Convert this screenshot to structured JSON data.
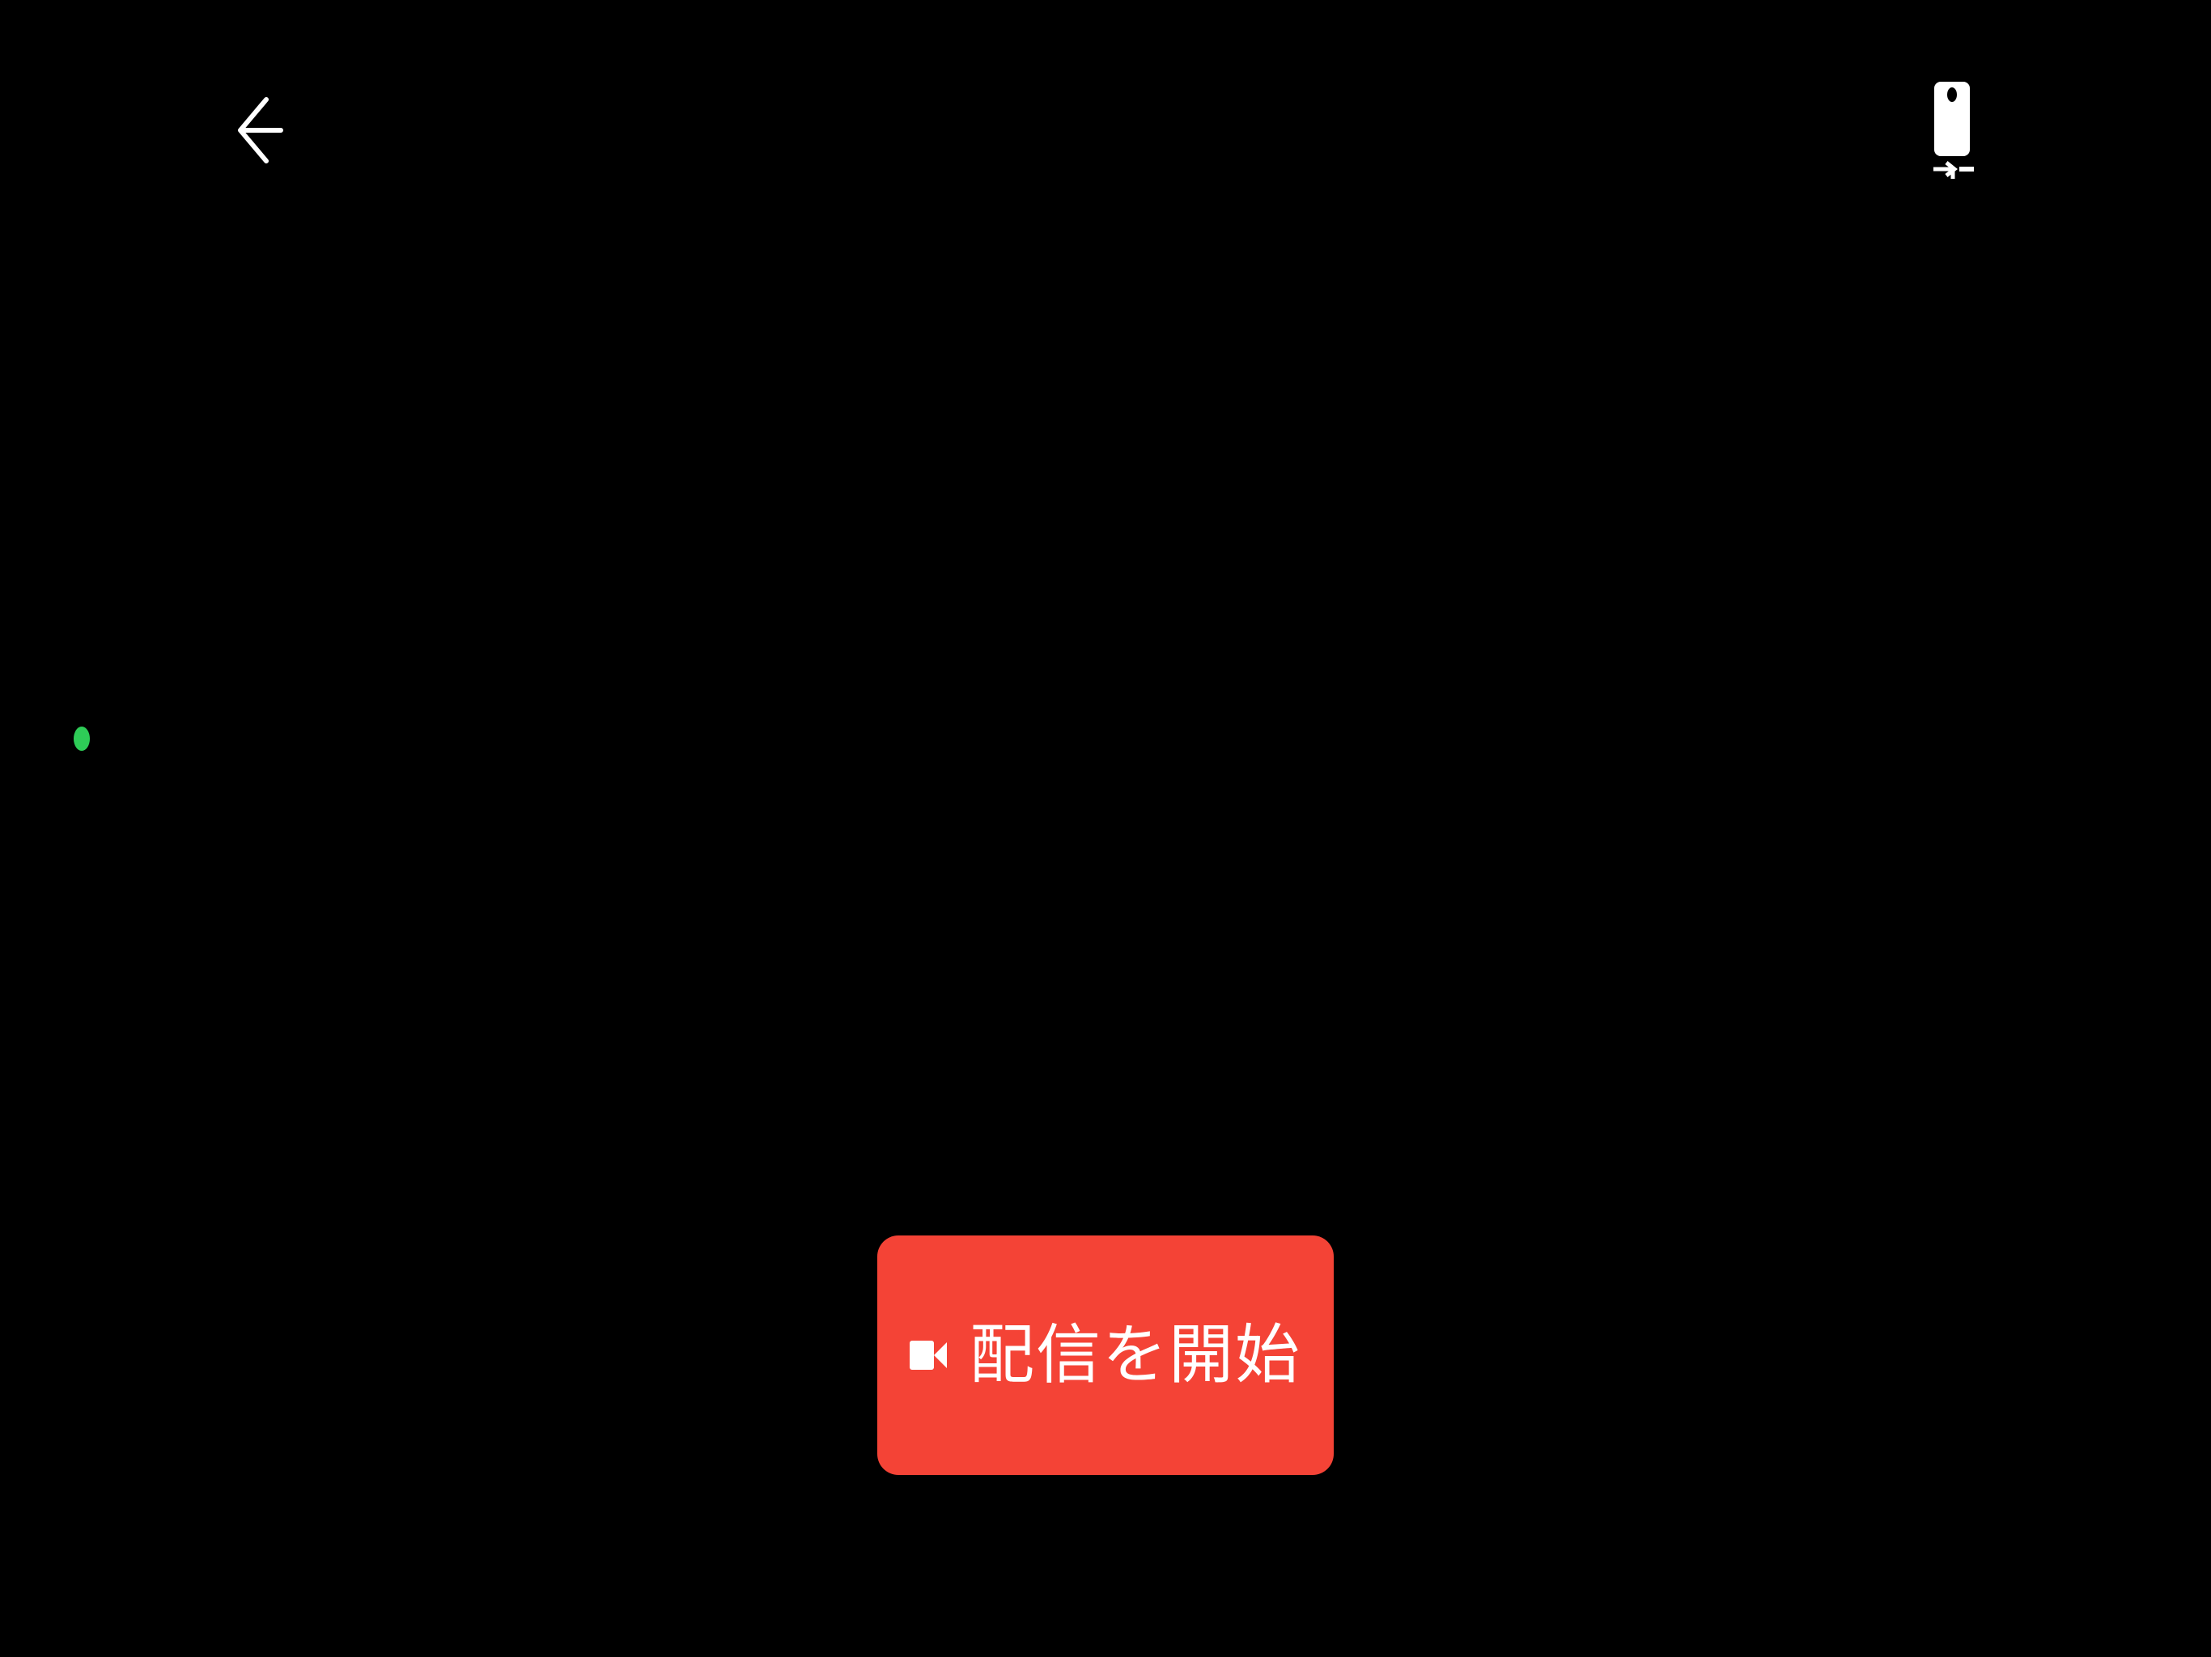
{
  "theme": {
    "background": "#000000",
    "accent": "#f44336",
    "status_color": "#2ecc57",
    "icon_color": "#ffffff"
  },
  "header": {
    "back_icon": "arrow-left-icon",
    "switch_camera_icon": "switch-camera-icon"
  },
  "status": {
    "indicator_icon": "green-dot"
  },
  "main": {
    "start_button": {
      "icon": "videocam-icon",
      "label": "配信を開始"
    }
  }
}
